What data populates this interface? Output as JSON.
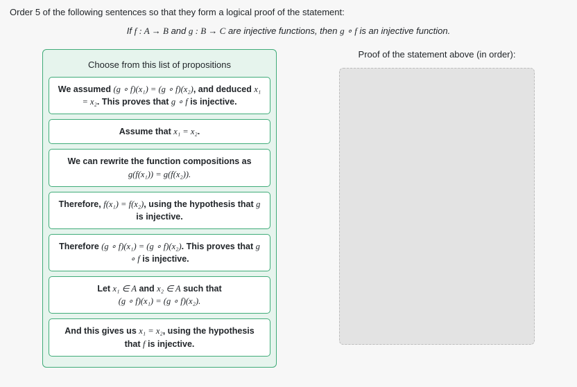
{
  "instruction": "Order 5 of the following sentences so that they form a logical proof of the statement:",
  "statement_prefix": "If ",
  "statement_f": "f : A → B",
  "statement_and": " and ",
  "statement_g": "g : B → C",
  "statement_mid": " are injective functions, then ",
  "statement_gof": "g ∘ f",
  "statement_suffix": " is an injective function.",
  "source_header": "Choose from this list of propositions",
  "target_header": "Proof of the statement above (in order):",
  "props": {
    "p1a": "We assumed ",
    "p1b": "(g ∘ f)(x₁) = (g ∘ f)(x₂)",
    "p1c": ", and deduced ",
    "p1d": "x₁ = x₂",
    "p1e": ". This proves that ",
    "p1f": "g ∘ f",
    "p1g": " is injective.",
    "p2a": "Assume that ",
    "p2b": "x₁ = x₂",
    "p2c": ".",
    "p3a": "We can rewrite the function compositions as",
    "p3b": "g(f(x₁)) = g(f(x₂)).",
    "p4a": "Therefore, ",
    "p4b": "f(x₁) = f(x₂)",
    "p4c": ", using the hypothesis that ",
    "p4d": "g",
    "p4e": " is injective.",
    "p5a": "Therefore ",
    "p5b": "(g ∘ f)(x₁) = (g ∘ f)(x₂)",
    "p5c": ". This proves that ",
    "p5d": "g ∘ f",
    "p5e": " is injective.",
    "p6a": "Let ",
    "p6b": "x₁ ∈ A",
    "p6c": " and ",
    "p6d": "x₂ ∈ A",
    "p6e": " such that",
    "p6f": "(g ∘ f)(x₁) = (g ∘ f)(x₂).",
    "p7a": "And this gives us ",
    "p7b": "x₁ = x₂",
    "p7c": ", using the hypothesis that ",
    "p7d": "f",
    "p7e": " is injective."
  }
}
